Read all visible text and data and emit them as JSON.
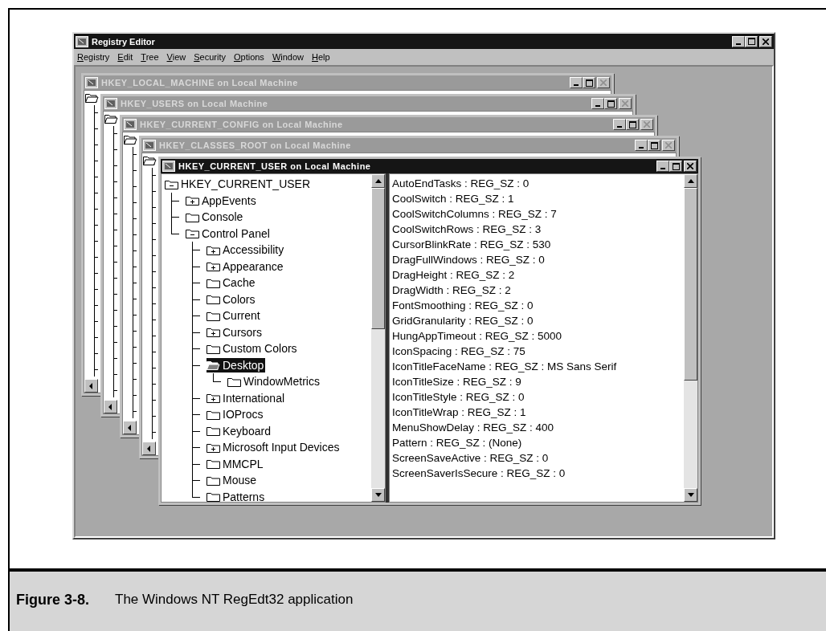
{
  "app": {
    "title": "Registry Editor",
    "menu": [
      "Registry",
      "Edit",
      "Tree",
      "View",
      "Security",
      "Options",
      "Window",
      "Help"
    ]
  },
  "windows": [
    {
      "title": "HKEY_LOCAL_MACHINE on Local Machine",
      "active": false
    },
    {
      "title": "HKEY_USERS on Local Machine",
      "active": false
    },
    {
      "title": "HKEY_CURRENT_CONFIG on Local Machine",
      "active": false
    },
    {
      "title": "HKEY_CLASSES_ROOT on Local Machine",
      "active": false
    },
    {
      "title": "HKEY_CURRENT_USER on Local Machine",
      "active": true,
      "tree": [
        {
          "label": "HKEY_CURRENT_USER",
          "kind": "branch",
          "expanded": true,
          "selected": false,
          "children": [
            {
              "label": "AppEvents",
              "kind": "branch",
              "expanded": false,
              "selected": false
            },
            {
              "label": "Console",
              "kind": "leaf",
              "expanded": false,
              "selected": false
            },
            {
              "label": "Control Panel",
              "kind": "branch",
              "expanded": true,
              "selected": false,
              "children": [
                {
                  "label": "Accessibility",
                  "kind": "branch",
                  "expanded": false,
                  "selected": false
                },
                {
                  "label": "Appearance",
                  "kind": "branch",
                  "expanded": false,
                  "selected": false
                },
                {
                  "label": "Cache",
                  "kind": "leaf",
                  "expanded": false,
                  "selected": false
                },
                {
                  "label": "Colors",
                  "kind": "leaf",
                  "expanded": false,
                  "selected": false
                },
                {
                  "label": "Current",
                  "kind": "leaf",
                  "expanded": false,
                  "selected": false
                },
                {
                  "label": "Cursors",
                  "kind": "branch",
                  "expanded": false,
                  "selected": false
                },
                {
                  "label": "Custom Colors",
                  "kind": "leaf",
                  "expanded": false,
                  "selected": false
                },
                {
                  "label": "Desktop",
                  "kind": "branch",
                  "expanded": true,
                  "selected": true,
                  "children": [
                    {
                      "label": "WindowMetrics",
                      "kind": "leaf",
                      "expanded": false,
                      "selected": false
                    }
                  ]
                },
                {
                  "label": "International",
                  "kind": "branch",
                  "expanded": false,
                  "selected": false
                },
                {
                  "label": "IOProcs",
                  "kind": "leaf",
                  "expanded": false,
                  "selected": false
                },
                {
                  "label": "Keyboard",
                  "kind": "leaf",
                  "expanded": false,
                  "selected": false
                },
                {
                  "label": "Microsoft Input Devices",
                  "kind": "branch",
                  "expanded": false,
                  "selected": false
                },
                {
                  "label": "MMCPL",
                  "kind": "leaf",
                  "expanded": false,
                  "selected": false
                },
                {
                  "label": "Mouse",
                  "kind": "leaf",
                  "expanded": false,
                  "selected": false
                },
                {
                  "label": "Patterns",
                  "kind": "leaf",
                  "expanded": false,
                  "selected": false
                }
              ]
            }
          ]
        }
      ],
      "values": [
        "AutoEndTasks : REG_SZ : 0",
        "CoolSwitch : REG_SZ : 1",
        "CoolSwitchColumns : REG_SZ : 7",
        "CoolSwitchRows : REG_SZ : 3",
        "CursorBlinkRate : REG_SZ : 530",
        "DragFullWindows : REG_SZ : 0",
        "DragHeight : REG_SZ : 2",
        "DragWidth : REG_SZ : 2",
        "FontSmoothing : REG_SZ : 0",
        "GridGranularity : REG_SZ : 0",
        "HungAppTimeout : REG_SZ : 5000",
        "IconSpacing : REG_SZ : 75",
        "IconTitleFaceName : REG_SZ : MS Sans Serif",
        "IconTitleSize : REG_SZ : 9",
        "IconTitleStyle : REG_SZ : 0",
        "IconTitleWrap : REG_SZ : 1",
        "MenuShowDelay : REG_SZ : 400",
        "Pattern : REG_SZ : (None)",
        "ScreenSaveActive : REG_SZ : 0",
        "ScreenSaverIsSecure : REG_SZ : 0"
      ]
    }
  ],
  "caption": {
    "label": "Figure 3-8.",
    "text": "The Windows NT RegEdt32 application"
  }
}
